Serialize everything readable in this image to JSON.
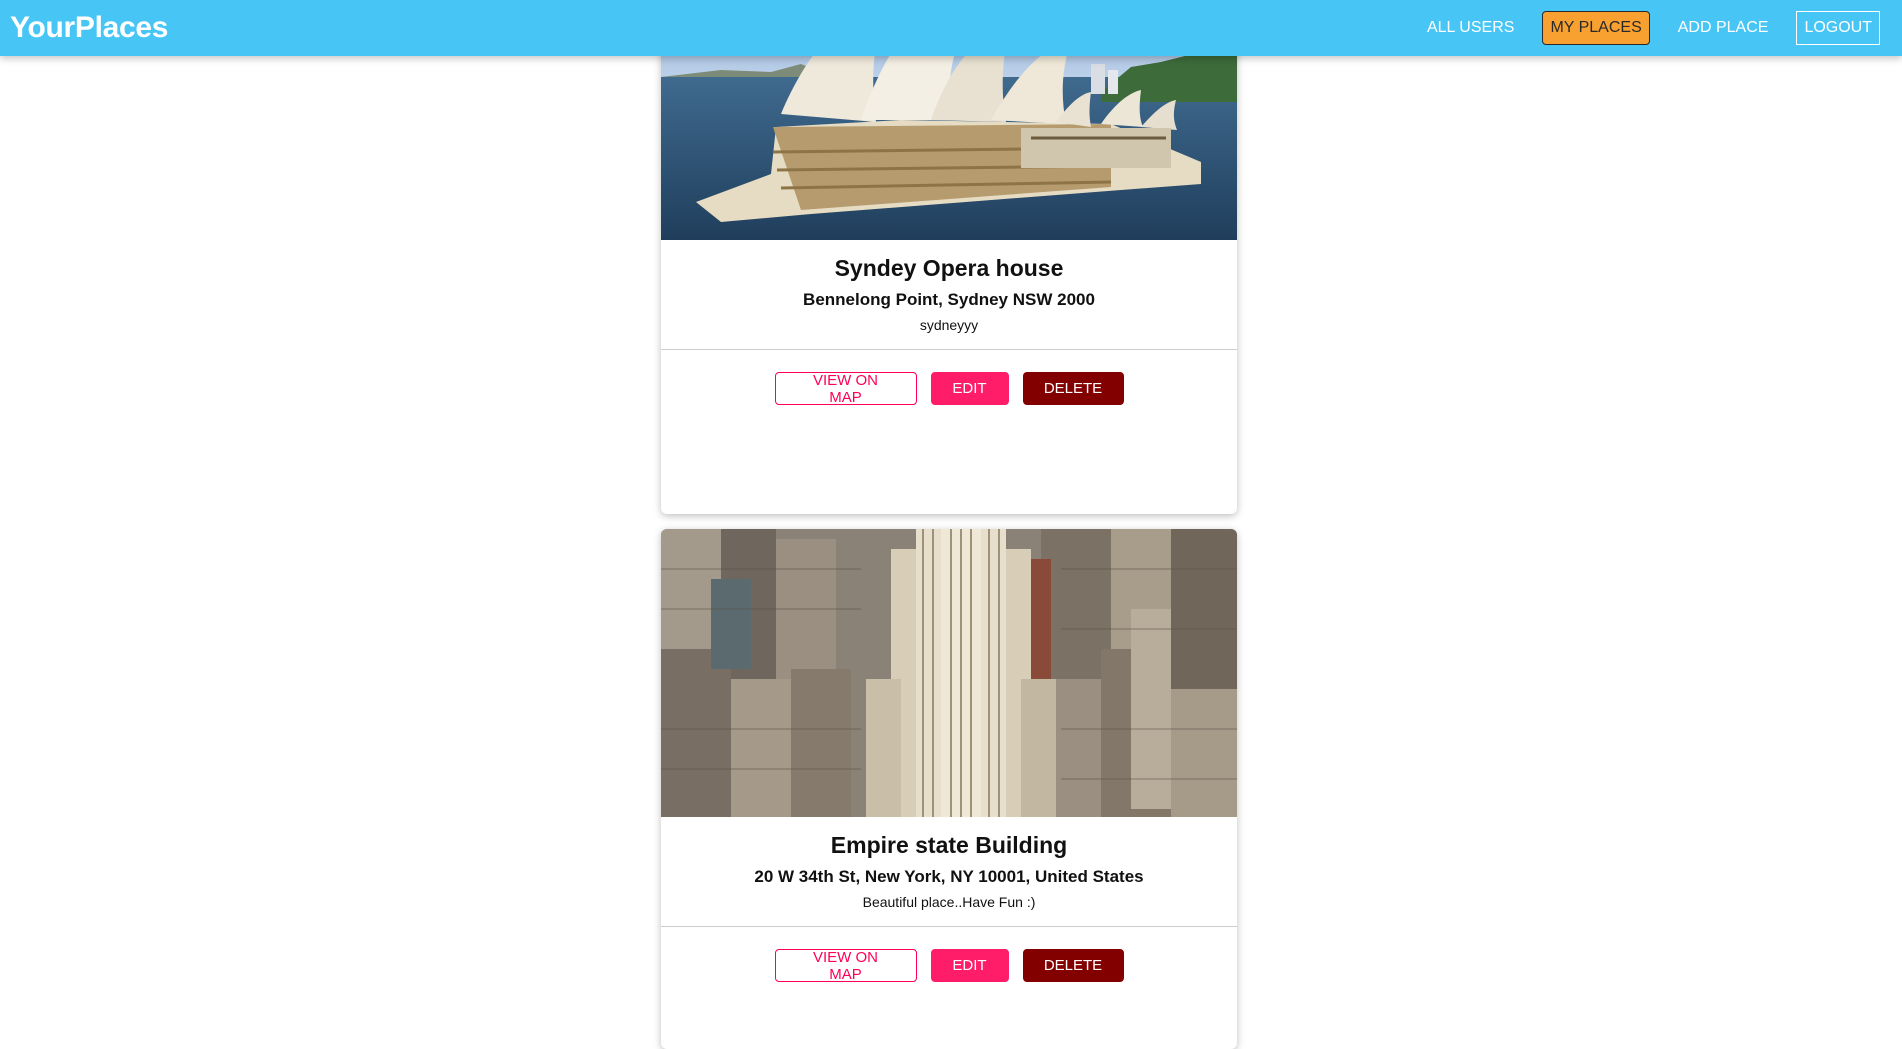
{
  "header": {
    "logo": "YourPlaces",
    "nav": {
      "all_users": "ALL USERS",
      "my_places": "MY PLACES",
      "add_place": "ADD PLACE",
      "logout": "LOGOUT"
    }
  },
  "places": [
    {
      "title": "Syndey Opera house",
      "address": "Bennelong Point, Sydney NSW 2000",
      "description": "sydneyyy",
      "actions": {
        "view": "VIEW ON MAP",
        "edit": "EDIT",
        "delete": "DELETE"
      }
    },
    {
      "title": "Empire state Building",
      "address": "20 W 34th St, New York, NY 10001, United States",
      "description": "Beautiful place..Have Fun :)",
      "actions": {
        "view": "VIEW ON MAP",
        "edit": "EDIT",
        "delete": "DELETE"
      }
    }
  ],
  "colors": {
    "header_bg": "#47c6f5",
    "active_nav": "#f8a130",
    "inverse_btn": "#ff0055",
    "edit_btn": "#ff1c68",
    "delete_btn": "#830000"
  }
}
